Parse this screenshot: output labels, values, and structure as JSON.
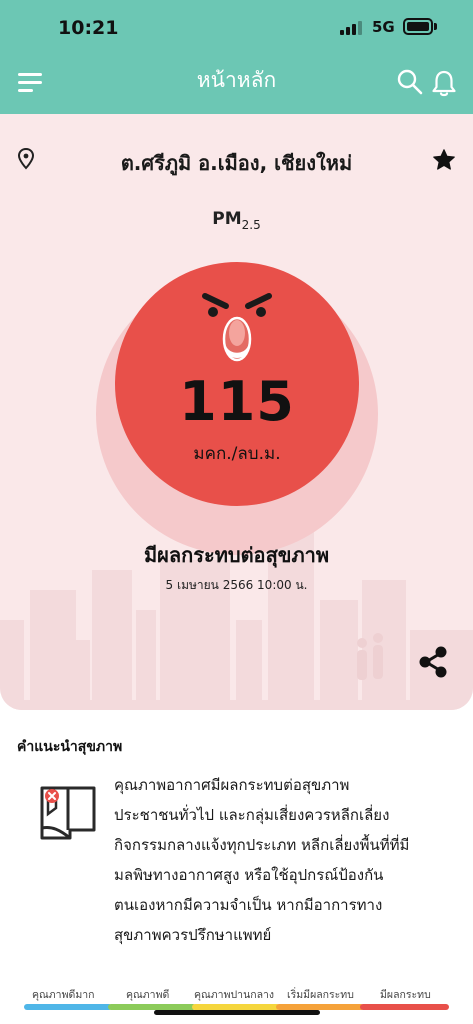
{
  "status_bar": {
    "time": "10:21",
    "network": "5G"
  },
  "header": {
    "title": "หน้าหลัก",
    "menu_icon": "hamburger-icon",
    "search_icon": "search-icon",
    "notification_icon": "bell-icon"
  },
  "location": {
    "text": "ต.ศรีภูมิ อ.เมือง, เชียงใหม่",
    "pin_icon": "location-pin-icon",
    "favorite_icon": "star-icon"
  },
  "pm": {
    "label": "PM",
    "sub": "2.5"
  },
  "aqi": {
    "value": "115",
    "unit": "มคก./ลบ.ม.",
    "face_icon": "angry-face-icon",
    "color": "#e8504a"
  },
  "level": {
    "text": "มีผลกระทบต่อสุขภาพ"
  },
  "updated": {
    "text": "5 เมษายน 2566  10:00 น."
  },
  "share_icon": "share-icon",
  "advice": {
    "title": "คำแนะนำสุขภาพ",
    "icon": "no-window-icon",
    "lines": [
      "คุณภาพอากาศมีผลกระทบต่อสุขภาพ",
      "ประชาชนทั่วไป และกลุ่มเสี่ยงควรหลีกเลี่ยง",
      "กิจกรรมกลางแจ้งทุกประเภท หลีกเลี่ยงพื้นที่ที่มี",
      "มลพิษทางอากาศสูง หรือใช้อุปกรณ์ป้องกัน",
      "ตนเองหากมีความจำเป็น หากมีอาการทาง",
      "สุขภาพควรปรึกษาแพทย์"
    ]
  },
  "legend": [
    {
      "label": "คุณภาพดีมาก",
      "color": "#4fb6e8"
    },
    {
      "label": "คุณภาพดี",
      "color": "#8ccb5a"
    },
    {
      "label": "คุณภาพปานกลาง",
      "color": "#f5d63d"
    },
    {
      "label": "เริ่มมีผลกระทบ",
      "color": "#f5a23a"
    },
    {
      "label": "มีผลกระทบ",
      "color": "#e8504a"
    }
  ]
}
